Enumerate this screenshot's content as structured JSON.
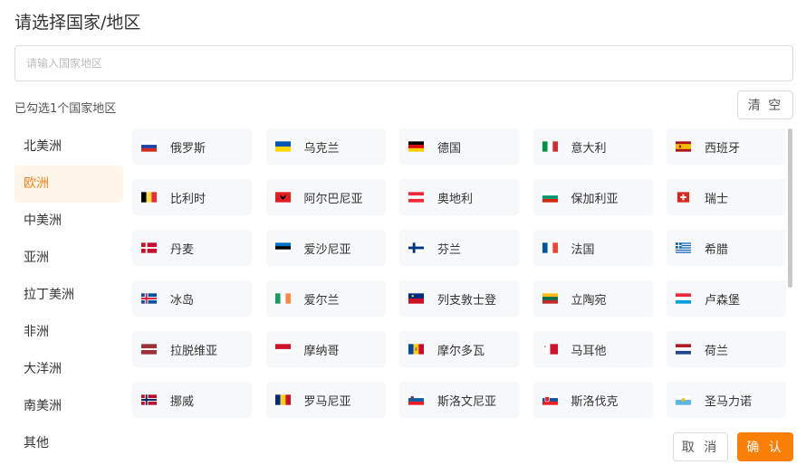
{
  "dialog": {
    "title": "请选择国家/地区",
    "search_placeholder": "请输入国家地区",
    "search_value": "",
    "selected_count_text": "已勾选1个国家地区",
    "clear_label": "清 空",
    "cancel_label": "取 消",
    "confirm_label": "确 认"
  },
  "colors": {
    "accent": "#fb7e06",
    "active_bg": "#fff6eb",
    "active_text": "#f5821f",
    "cell_bg": "#f7f8fa"
  },
  "regions": [
    {
      "label": "北美洲",
      "active": false
    },
    {
      "label": "欧洲",
      "active": true
    },
    {
      "label": "中美洲",
      "active": false
    },
    {
      "label": "亚洲",
      "active": false
    },
    {
      "label": "拉丁美洲",
      "active": false
    },
    {
      "label": "非洲",
      "active": false
    },
    {
      "label": "大洋洲",
      "active": false
    },
    {
      "label": "南美洲",
      "active": false
    },
    {
      "label": "其他",
      "active": false
    }
  ],
  "countries": [
    {
      "name": "俄罗斯",
      "flag": "russia-flag-icon"
    },
    {
      "name": "乌克兰",
      "flag": "ukraine-flag-icon"
    },
    {
      "name": "德国",
      "flag": "germany-flag-icon"
    },
    {
      "name": "意大利",
      "flag": "italy-flag-icon"
    },
    {
      "name": "西班牙",
      "flag": "spain-flag-icon"
    },
    {
      "name": "比利时",
      "flag": "belgium-flag-icon"
    },
    {
      "name": "阿尔巴尼亚",
      "flag": "albania-flag-icon"
    },
    {
      "name": "奥地利",
      "flag": "austria-flag-icon"
    },
    {
      "name": "保加利亚",
      "flag": "bulgaria-flag-icon"
    },
    {
      "name": "瑞士",
      "flag": "switzerland-flag-icon"
    },
    {
      "name": "丹麦",
      "flag": "denmark-flag-icon"
    },
    {
      "name": "爱沙尼亚",
      "flag": "estonia-flag-icon"
    },
    {
      "name": "芬兰",
      "flag": "finland-flag-icon"
    },
    {
      "name": "法国",
      "flag": "france-flag-icon"
    },
    {
      "name": "希腊",
      "flag": "greece-flag-icon"
    },
    {
      "name": "冰岛",
      "flag": "iceland-flag-icon"
    },
    {
      "name": "爱尔兰",
      "flag": "ireland-flag-icon"
    },
    {
      "name": "列支敦士登",
      "flag": "liechtenstein-flag-icon"
    },
    {
      "name": "立陶宛",
      "flag": "lithuania-flag-icon"
    },
    {
      "name": "卢森堡",
      "flag": "luxembourg-flag-icon"
    },
    {
      "name": "拉脱维亚",
      "flag": "latvia-flag-icon"
    },
    {
      "name": "摩纳哥",
      "flag": "monaco-flag-icon"
    },
    {
      "name": "摩尔多瓦",
      "flag": "moldova-flag-icon"
    },
    {
      "name": "马耳他",
      "flag": "malta-flag-icon"
    },
    {
      "name": "荷兰",
      "flag": "netherlands-flag-icon"
    },
    {
      "name": "挪威",
      "flag": "norway-flag-icon"
    },
    {
      "name": "罗马尼亚",
      "flag": "romania-flag-icon"
    },
    {
      "name": "斯洛文尼亚",
      "flag": "slovenia-flag-icon"
    },
    {
      "name": "斯洛伐克",
      "flag": "slovakia-flag-icon"
    },
    {
      "name": "圣马力诺",
      "flag": "san-marino-flag-icon"
    }
  ]
}
